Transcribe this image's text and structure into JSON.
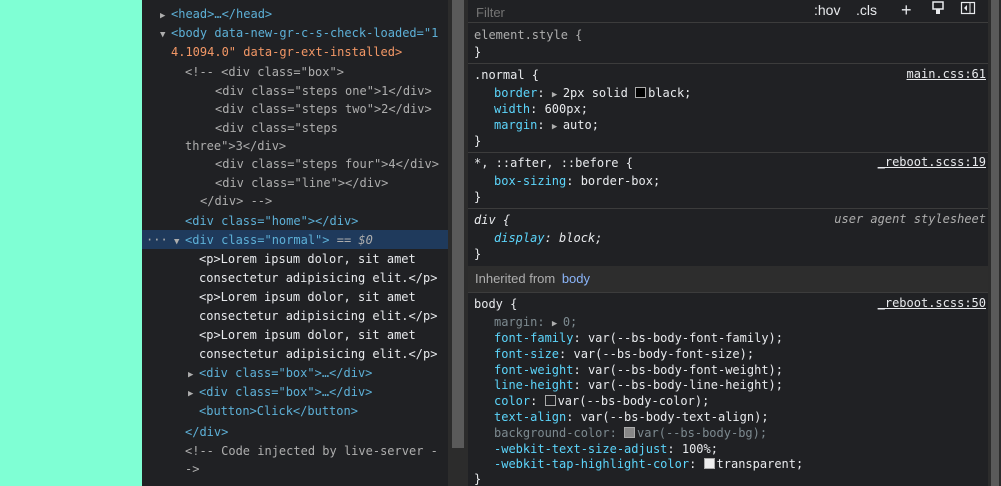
{
  "elements": {
    "lines": [
      "<head>…</head>",
      "<body data-new-gr-c-s-check-loaded=\"1",
      "4.1094.0\" data-gr-ext-installed>",
      "<!-- <div class=\"box\">",
      "<div class=\"steps one\">1</div>",
      "<div class=\"steps two\">2</div>",
      "<div class=\"steps",
      "three\">3</div>",
      "<div class=\"steps four\">4</div>",
      "<div class=\"line\"></div>",
      "</div> -->",
      "<div class=\"home\"></div>",
      "<div class=\"normal\">",
      "== $0",
      "<p>Lorem ipsum dolor, sit amet",
      "consectetur adipisicing elit.</p>",
      "<p>Lorem ipsum dolor, sit amet",
      "consectetur adipisicing elit.</p>",
      "<p>Lorem ipsum dolor, sit amet",
      "consectetur adipisicing elit.</p>",
      "<div class=\"box\">…</div>",
      "<div class=\"box\">…</div>",
      "<button>Click</button>",
      "</div>",
      "<!-- Code injected by live-server -",
      "->"
    ],
    "dots": "···"
  },
  "styles": {
    "filter_placeholder": "Filter",
    "hov": ":hov",
    "cls": ".cls",
    "plus": "+",
    "rules": [
      {
        "selector": "element.style {",
        "close": "}"
      },
      {
        "selector": ".normal {",
        "source": "main.css:61",
        "props": [
          {
            "name": "border",
            "value": "2px solid black"
          },
          {
            "name": "width",
            "value": "600px;"
          },
          {
            "name": "margin",
            "value": "auto;"
          }
        ],
        "close": "}"
      },
      {
        "selector": "*, ::after, ::before {",
        "source": "_reboot.scss:19",
        "props": [
          {
            "name": "box-sizing",
            "value": "border-box;"
          }
        ],
        "close": "}"
      },
      {
        "selector": "div {",
        "source": "user agent stylesheet",
        "props": [
          {
            "name": "display",
            "value": "block;"
          }
        ],
        "close": "}"
      },
      {
        "selector": "body {",
        "source": "_reboot.scss:50",
        "props": [
          {
            "name": "margin",
            "value": "0;"
          },
          {
            "name": "font-family",
            "value": "var(--bs-body-font-family);"
          },
          {
            "name": "font-size",
            "value": "var(--bs-body-font-size);"
          },
          {
            "name": "font-weight",
            "value": "var(--bs-body-font-weight);"
          },
          {
            "name": "line-height",
            "value": "var(--bs-body-line-height);"
          },
          {
            "name": "color",
            "value": "var(--bs-body-color);"
          },
          {
            "name": "text-align",
            "value": "var(--bs-body-text-align);"
          },
          {
            "name": "background-color",
            "value": "var(--bs-body-bg);"
          },
          {
            "name": "-webkit-text-size-adjust",
            "value": "100%;"
          },
          {
            "name": "-webkit-tap-highlight-color",
            "value": "transparent;"
          }
        ],
        "close": "}"
      }
    ],
    "inherited_label": "Inherited from",
    "inherited_from": "body"
  },
  "colors": {
    "page_bg": "#7fffd4",
    "panel_bg": "#202124",
    "selection": "#1f3a5c"
  }
}
